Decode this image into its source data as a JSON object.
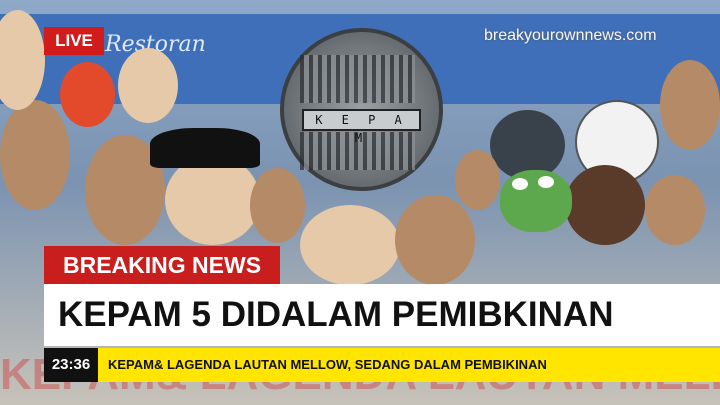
{
  "background": {
    "banner_text": "Restoran",
    "manhole_label": "K E P A M"
  },
  "overlay": {
    "live_label": "LIVE",
    "watermark": "breakyourownnews.com",
    "breaking_label": "BREAKING NEWS",
    "headline": "KEPAM 5 DIDALAM PEMIBKINAN",
    "time": "23:36",
    "ticker": "KEPAM& LAGENDA LAUTAN MELLOW, SEDANG DALAM PEMBIKINAN"
  },
  "colors": {
    "live_red": "#d21c1c",
    "ticker_yellow": "#ffe500",
    "banner_blue": "#3f6fb8"
  }
}
